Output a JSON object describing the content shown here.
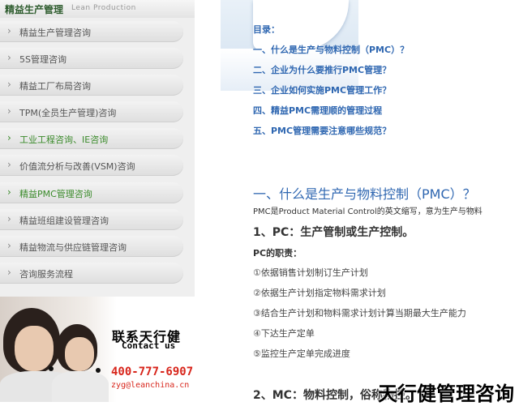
{
  "sidebar": {
    "title": "精益生产管理",
    "subtitle": "Lean Production",
    "items": [
      {
        "label": "精益生产管理咨询",
        "active": false
      },
      {
        "label": "5S管理咨询",
        "active": false
      },
      {
        "label": "精益工厂布局咨询",
        "active": false
      },
      {
        "label": "TPM(全员生产管理)咨询",
        "active": false
      },
      {
        "label": "工业工程咨询、IE咨询",
        "active": true
      },
      {
        "label": "价值流分析与改善(VSM)咨询",
        "active": false
      },
      {
        "label": "精益PMC管理咨询",
        "active": true
      },
      {
        "label": "精益班组建设管理咨询",
        "active": false
      },
      {
        "label": "精益物流与供应链管理咨询",
        "active": false
      },
      {
        "label": "咨询服务流程",
        "active": false
      }
    ]
  },
  "contact": {
    "cn": "联系天行健",
    "en": "Contact us",
    "phone": "400-777-6907",
    "email": "zyg@leanchina.cn"
  },
  "content": {
    "toc_title": "目录：",
    "toc": [
      "一、什么是生产与物料控制（PMC）？",
      "二、企业为什么要推行PMC管理？",
      "三、企业如何实施PMC管理工作？",
      "四、精益PMC需理顺的管理过程",
      "五、PMC管理需要注意哪些规范？"
    ],
    "section1_title": "一、什么是生产与物料控制（PMC）？",
    "section1_desc": "PMC是Product Material Control的英文缩写，意为生产与物料",
    "sub_pc": "1、PC：生产管制或生产控制。",
    "pc_duty_title": "PC的职责：",
    "pc_duties": [
      "①依据销售计划制订生产计划",
      "②依据生产计划指定物料需求计划",
      "③结合生产计划和物料需求计划计算当期最大生产能力",
      "④下达生产定单",
      "⑤监控生产定单完成进度"
    ],
    "sub_mc": "2、MC：物料控制，俗称物控。",
    "watermark": "天行健管理咨询"
  }
}
